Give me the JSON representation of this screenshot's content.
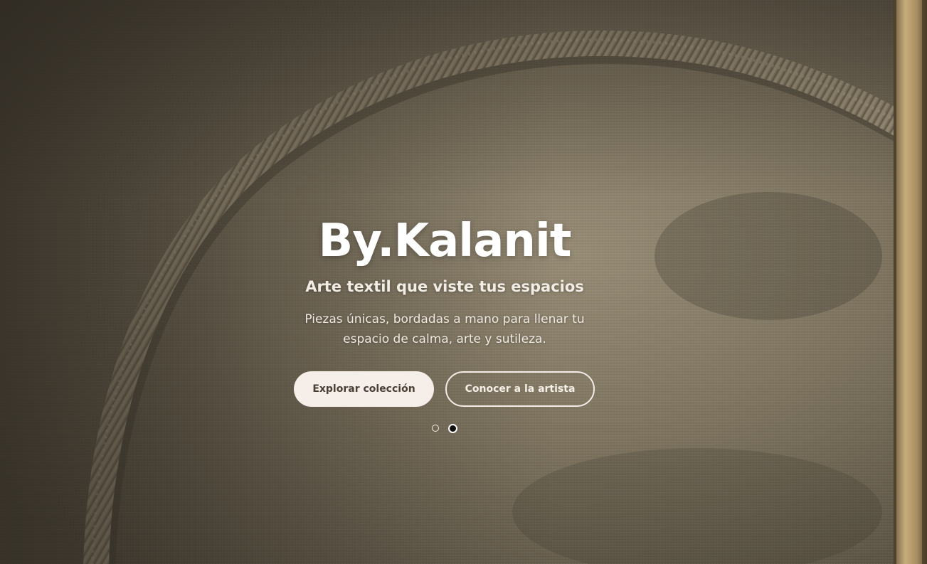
{
  "hero": {
    "brand": "By.Kalanit",
    "tagline": "Arte textil que viste tus espacios",
    "description": "Piezas únicas, bordadas a mano para llenar tu espacio de calma, arte y sutileza.",
    "background_image": "embroidered-linen-arch-photo"
  },
  "buttons": {
    "primary_label": "Explorar colección",
    "secondary_label": "Conocer a la artista"
  },
  "carousel": {
    "slides": 2,
    "active_slide": 2
  },
  "colors": {
    "primary_button_bg": "#f6efe9",
    "primary_button_text": "#4a3f35",
    "text_light": "#ffffff",
    "linen_base": "#7a7160"
  }
}
